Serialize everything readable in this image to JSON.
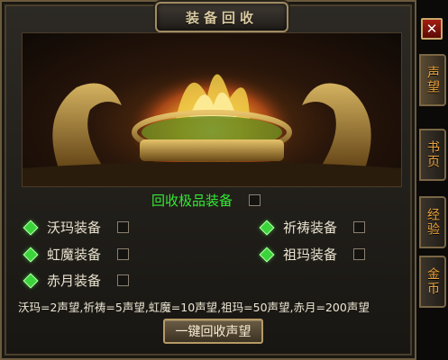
{
  "window": {
    "title": "装备回收",
    "close_label": "✕"
  },
  "side_tabs": [
    {
      "label": "声望",
      "active": true
    },
    {
      "label": "书页",
      "active": false
    },
    {
      "label": "经验",
      "active": false
    },
    {
      "label": "金币",
      "active": false
    }
  ],
  "recycle_premium": {
    "label": "回收极品装备",
    "checked": false
  },
  "options": [
    {
      "label": "沃玛装备",
      "checked": false
    },
    {
      "label": "祈祷装备",
      "checked": false
    },
    {
      "label": "虹魔装备",
      "checked": false
    },
    {
      "label": "祖玛装备",
      "checked": false
    },
    {
      "label": "赤月装备",
      "checked": false
    }
  ],
  "rates_text": "沃玛=2声望,祈祷=5声望,虹魔=10声望,祖玛=50声望,赤月=200声望",
  "recycle_button": "一键回收声望",
  "colors": {
    "premium_label": "#35e835",
    "tab_text": "#e8a23c",
    "gem": "#3bd43b",
    "close": "#a41d12"
  }
}
